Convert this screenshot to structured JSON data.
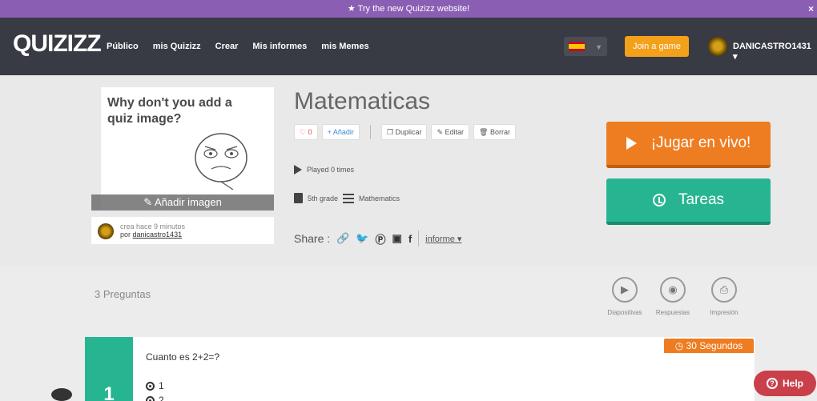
{
  "promo": {
    "text": "★ Try the new Quizizz website!",
    "close": "×"
  },
  "nav": {
    "logo": "QUIZIZZ",
    "links": [
      "Público",
      "mis Quizizz",
      "Crear",
      "Mis informes",
      "mis Memes"
    ],
    "join_label": "Join a game",
    "username": "DANICASTRO1431 ▾"
  },
  "quiz": {
    "image_prompt": "Why don't you add a quiz image?",
    "add_image_label": "Añadir imagen",
    "created_text": "crea hace 9 minutos",
    "by_prefix": "por",
    "creator": "danicastro1431",
    "title": "Matematicas",
    "likes": "0",
    "add_label": "+ Añadir",
    "duplicate_label": "Duplicar",
    "edit_label": "Editar",
    "delete_label": "Borrar",
    "played": "Played 0 times",
    "grade": "5th grade",
    "subject": "Mathematics",
    "share_label": "Share :",
    "report_label": "informe ▾",
    "live_label": "¡Jugar en vivo!",
    "tareas_label": "Tareas"
  },
  "questions": {
    "count_label": "3 Preguntas",
    "tools": [
      {
        "icon": "play-icon",
        "label": "Diapositivas"
      },
      {
        "icon": "eye-icon",
        "label": "Respuestas"
      },
      {
        "icon": "print-icon",
        "label": "Impresión"
      }
    ],
    "timer_label": "30 Segundos",
    "question_number": "1",
    "question_text": "Cuanto es 2+2=?",
    "options": [
      "1",
      "2"
    ]
  },
  "help_label": "Help"
}
